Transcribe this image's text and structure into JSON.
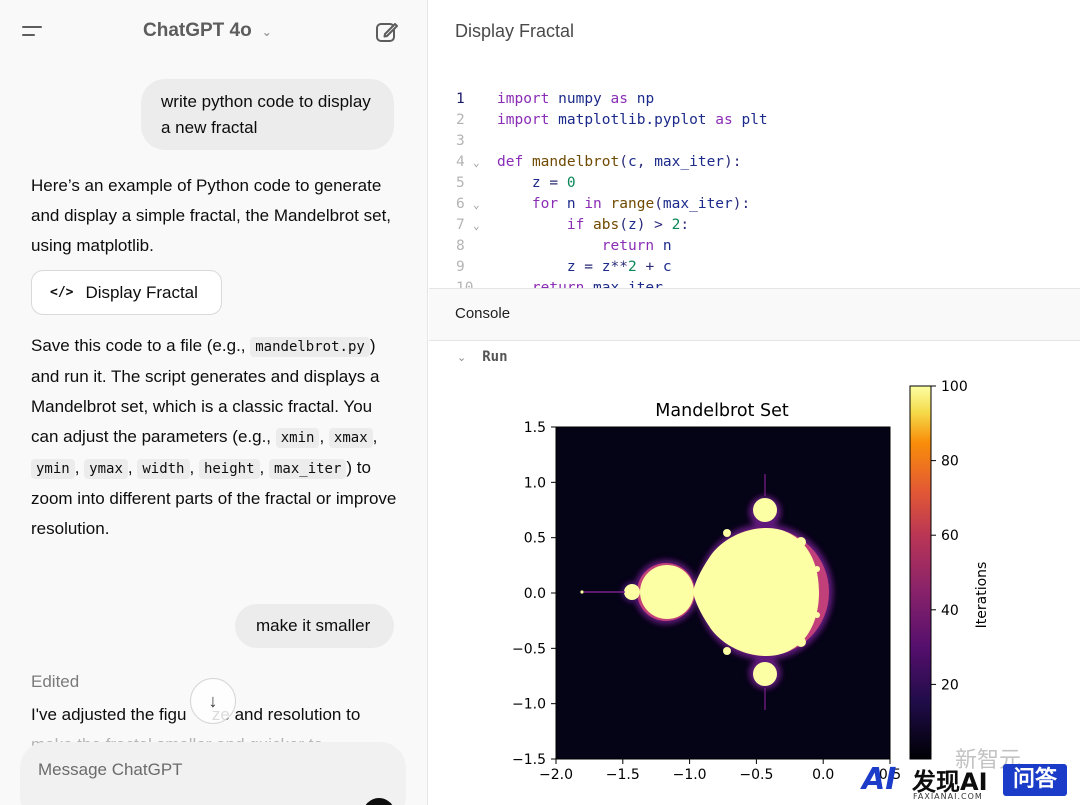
{
  "chat": {
    "model_label": "ChatGPT 4o",
    "messages": {
      "user1": "write python code to display a new fractal",
      "assistant1": "Here’s an example of Python code to generate and display a simple fractal, the Mandelbrot set, using matplotlib.",
      "canvas_button_icon": "</>",
      "canvas_button_label": "Display Fractal",
      "assistant2": {
        "p1": "Save this code to a file (e.g., ",
        "c1": "mandelbrot.py",
        "p2": ") and run it. The script generates and displays a Mandelbrot set, which is a classic fractal. You can adjust the parameters (e.g., ",
        "c2": "xmin",
        "s2": ", ",
        "c3": "xmax",
        "s3": ", ",
        "c4": "ymin",
        "s4": ", ",
        "c5": "ymax",
        "s5": ", ",
        "c6": "width",
        "s6": ", ",
        "c7": "height",
        "s7": ", ",
        "c8": "max_iter",
        "p3": ") to zoom into different parts of the fractal or improve resolution."
      },
      "user2": "make it smaller",
      "edited_label": "Edited",
      "assistant3": "I've adjusted the figu   ze and resolution to",
      "assistant3_tail": "make the fractal smaller and quicker to"
    },
    "composer_placeholder": "Message ChatGPT",
    "icons": {
      "menu": "hamburger-icon",
      "new_chat": "edit-icon",
      "scroll": "arrow-down-icon",
      "model_chevron": "chevron-down-icon"
    }
  },
  "canvas": {
    "title": "Display Fractal",
    "code_lines": [
      {
        "n": "1",
        "text": "import numpy as np"
      },
      {
        "n": "2",
        "text": "import matplotlib.pyplot as plt"
      },
      {
        "n": "3",
        "text": ""
      },
      {
        "n": "4",
        "text": "def mandelbrot(c, max_iter):"
      },
      {
        "n": "5",
        "text": "    z = 0"
      },
      {
        "n": "6",
        "text": "    for n in range(max_iter):"
      },
      {
        "n": "7",
        "text": "        if abs(z) > 2:"
      },
      {
        "n": "8",
        "text": "            return n"
      },
      {
        "n": "9",
        "text": "        z = z**2 + c"
      },
      {
        "n": "10",
        "text": "    return max_iter"
      }
    ],
    "console_label": "Console",
    "run_label": "Run"
  },
  "chart_data": {
    "type": "heatmap",
    "title": "Mandelbrot Set",
    "xlabel": "",
    "ylabel": "",
    "xlim": [
      -2.0,
      0.5
    ],
    "ylim": [
      -1.5,
      1.5
    ],
    "xticks": [
      "−2.0",
      "−1.5",
      "−1.0",
      "−0.5",
      "0.0",
      "0.5"
    ],
    "yticks": [
      "1.5",
      "1.0",
      "0.5",
      "0.0",
      "−0.5",
      "−1.0",
      "−1.5"
    ],
    "colorbar": {
      "label": "Iterations",
      "range": [
        0,
        100
      ],
      "ticks": [
        "100",
        "80",
        "60",
        "40",
        "20"
      ],
      "colormap": "inferno"
    },
    "colors": {
      "background": "#050316",
      "set": "#fcffa4",
      "edge": "#7a1f8a"
    }
  },
  "watermark": {
    "brand_ai": "AI",
    "brand_cn": "发现AI",
    "brand_sub": "FAXIANAI.COM",
    "brand_box": "问答",
    "faint": "新智元"
  }
}
